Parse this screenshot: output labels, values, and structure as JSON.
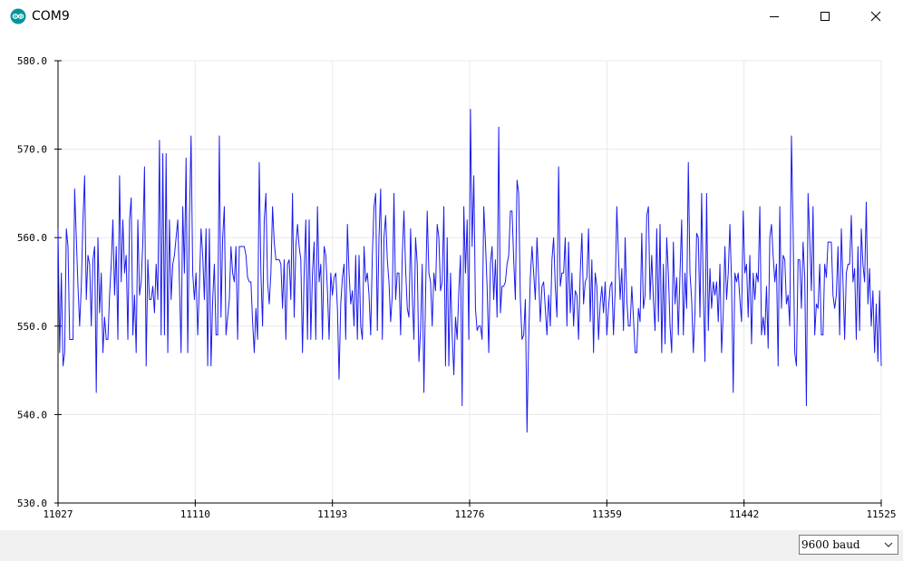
{
  "window": {
    "title": "COM9",
    "app_icon": "arduino-logo-icon",
    "controls": [
      "minimize-icon",
      "maximize-icon",
      "close-icon"
    ]
  },
  "colors": {
    "series": "#1a1aee",
    "accent": "#00979c",
    "grid": "#e8e8e8",
    "bottom_bar": "#f0f0f0"
  },
  "chart_data": {
    "type": "line",
    "title": "",
    "xlabel": "",
    "ylabel": "",
    "x_start": 11027,
    "x_end": 11525,
    "xlim": [
      11027,
      11525
    ],
    "ylim": [
      530,
      580
    ],
    "x_ticks": [
      "11027",
      "11110",
      "11193",
      "11276",
      "11359",
      "11442",
      "11525"
    ],
    "y_ticks": [
      "530.0",
      "540.0",
      "550.0",
      "560.0",
      "570.0",
      "580.0"
    ],
    "grid": true,
    "legend": "none",
    "series": [
      {
        "values": [
          561,
          547,
          556,
          545.5,
          547,
          561,
          559,
          548.5,
          548.5,
          548.5,
          565.5,
          560,
          554.5,
          550,
          554.5,
          562,
          567,
          553,
          558,
          557,
          550,
          557.5,
          559,
          542.5,
          560,
          551.5,
          556,
          547,
          551,
          548.5,
          548.5,
          553.5,
          557,
          562,
          553.5,
          559,
          548.5,
          567,
          555,
          562,
          556,
          558,
          548.5,
          562,
          564.5,
          549,
          553.5,
          547,
          562,
          553.5,
          555,
          559.5,
          568,
          545.5,
          557.5,
          553,
          553,
          554.5,
          551.5,
          557,
          553,
          571,
          549,
          569.5,
          549,
          569.5,
          547,
          562,
          553,
          557,
          558,
          560,
          562,
          555,
          547,
          563.5,
          556,
          569,
          547,
          562,
          571.5,
          556,
          553,
          556,
          549,
          554.5,
          561,
          558,
          553,
          561,
          545.5,
          561,
          545.5,
          553,
          557,
          549,
          549,
          571.5,
          551,
          560,
          563.5,
          549,
          551,
          553,
          559,
          556,
          555,
          559,
          548.5,
          559,
          559,
          559,
          559,
          558,
          555.5,
          555,
          555,
          550.5,
          547,
          552,
          548.5,
          568.5,
          556,
          550,
          562,
          565,
          555,
          552.5,
          556,
          563.5,
          559.5,
          557.5,
          557.5,
          557.5,
          557,
          552,
          557.5,
          548.5,
          557,
          557.5,
          553,
          565,
          551,
          559,
          561.5,
          559,
          557.5,
          547,
          556,
          562,
          548.5,
          562,
          548.5,
          556,
          559.5,
          548.5,
          563.5,
          555,
          557,
          548.5,
          559,
          558,
          554,
          548.5,
          556,
          553.5,
          555.5,
          556,
          552,
          544,
          552.5,
          555.5,
          557,
          548.5,
          561.5,
          556,
          552.5,
          554,
          550,
          558,
          548.5,
          558,
          550,
          548.5,
          559,
          555,
          556,
          553.5,
          549,
          558,
          563.5,
          565,
          549.5,
          560,
          565.5,
          548.5,
          560,
          562.5,
          557.5,
          555,
          550.5,
          553.5,
          565,
          553,
          556,
          556,
          549,
          558,
          563,
          556.5,
          552,
          551,
          561,
          553.5,
          548.5,
          560,
          557,
          546,
          549.5,
          557,
          542.5,
          553.5,
          563,
          556,
          555,
          550,
          556,
          554,
          561.5,
          560,
          554,
          555,
          563.5,
          545.5,
          560,
          545.5,
          556,
          549,
          544.5,
          551,
          548.5,
          554,
          558,
          541,
          563.5,
          556,
          562,
          548.5,
          574.5,
          559,
          567,
          552,
          549.5,
          550,
          550,
          548.5,
          563.5,
          559.5,
          554.5,
          547,
          557,
          559,
          553,
          557.5,
          551,
          572.5,
          551.5,
          554.5,
          554.5,
          555,
          557,
          558,
          563,
          563,
          557.5,
          553,
          566.5,
          565,
          553,
          548.5,
          549,
          553,
          538,
          548.5,
          555.5,
          559,
          556,
          553,
          560,
          555.5,
          550.5,
          554.5,
          555,
          552,
          549,
          553.5,
          550,
          557.5,
          560,
          554.5,
          551,
          568,
          554.5,
          556,
          556,
          560,
          550,
          559.5,
          551.5,
          556,
          550,
          554,
          553.5,
          548.5,
          556,
          560.5,
          552.5,
          555,
          555.5,
          561,
          550.5,
          557.5,
          547,
          556,
          554.5,
          548.5,
          552.5,
          554.5,
          551.5,
          555,
          549,
          552,
          554.5,
          555,
          549,
          554,
          563.5,
          558,
          553,
          556.5,
          549.5,
          560,
          553,
          550,
          550,
          554.5,
          551,
          547,
          547,
          552,
          550.5,
          560.5,
          552,
          553.5,
          562.5,
          563.5,
          553,
          558,
          553,
          549.5,
          561,
          550.5,
          561.5,
          547,
          557,
          548,
          560,
          556,
          550,
          547,
          559.5,
          552.5,
          555.5,
          549,
          556,
          562,
          549,
          556,
          552,
          568.5,
          556,
          553,
          547,
          551.5,
          560.5,
          560,
          551,
          565,
          554,
          546,
          565,
          549.5,
          556.5,
          552,
          555,
          553.5,
          555,
          550.5,
          557,
          547,
          551.5,
          559,
          553,
          556,
          561.5,
          555,
          542.5,
          556,
          555,
          556,
          553,
          550.5,
          563,
          556,
          557,
          551,
          558,
          548,
          556,
          553,
          556,
          555,
          563.5,
          549,
          551,
          549,
          554.5,
          547.5,
          560,
          561.5,
          558,
          555,
          557,
          545.5,
          563.5,
          552,
          558,
          557.5,
          552.5,
          553.5,
          550,
          571.5,
          561,
          547,
          545.5,
          557.5,
          557.5,
          552,
          559.5,
          555.5,
          541,
          565,
          560,
          554,
          563.5,
          549,
          552.5,
          552,
          557,
          549,
          549,
          557,
          555.5,
          559.5,
          559.5,
          559.5,
          553.5,
          552,
          553.5,
          559,
          549,
          561,
          555,
          548.5,
          556,
          557,
          557,
          562.5,
          555,
          556.5,
          548.5,
          559,
          549.5,
          561,
          557,
          555,
          564,
          552.5,
          556.5,
          550,
          554,
          547,
          552.5,
          546,
          554,
          545.5
        ]
      }
    ]
  },
  "bottom_bar": {
    "baud_selected": "9600 baud",
    "baud_arrow": "chevron-down-icon"
  }
}
